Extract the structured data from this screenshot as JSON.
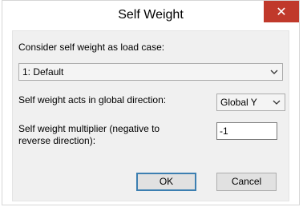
{
  "window": {
    "title": "Self Weight",
    "close_glyph": "✕"
  },
  "form": {
    "load_case_label": "Consider self weight as load case:",
    "load_case_value": "1: Default",
    "direction_label": "Self weight acts in global direction:",
    "direction_value": "Global Y",
    "multiplier_label_line1": "Self weight multiplier (negative to",
    "multiplier_label_line2": "reverse direction):",
    "multiplier_value": "-1"
  },
  "buttons": {
    "ok": "OK",
    "cancel": "Cancel"
  },
  "icons": {
    "close": "close-icon",
    "dropdown": "chevron-down-icon"
  },
  "colors": {
    "close_bg": "#c0392b",
    "client_bg": "#f0f0f0",
    "default_button_border": "#3c7fb1"
  }
}
